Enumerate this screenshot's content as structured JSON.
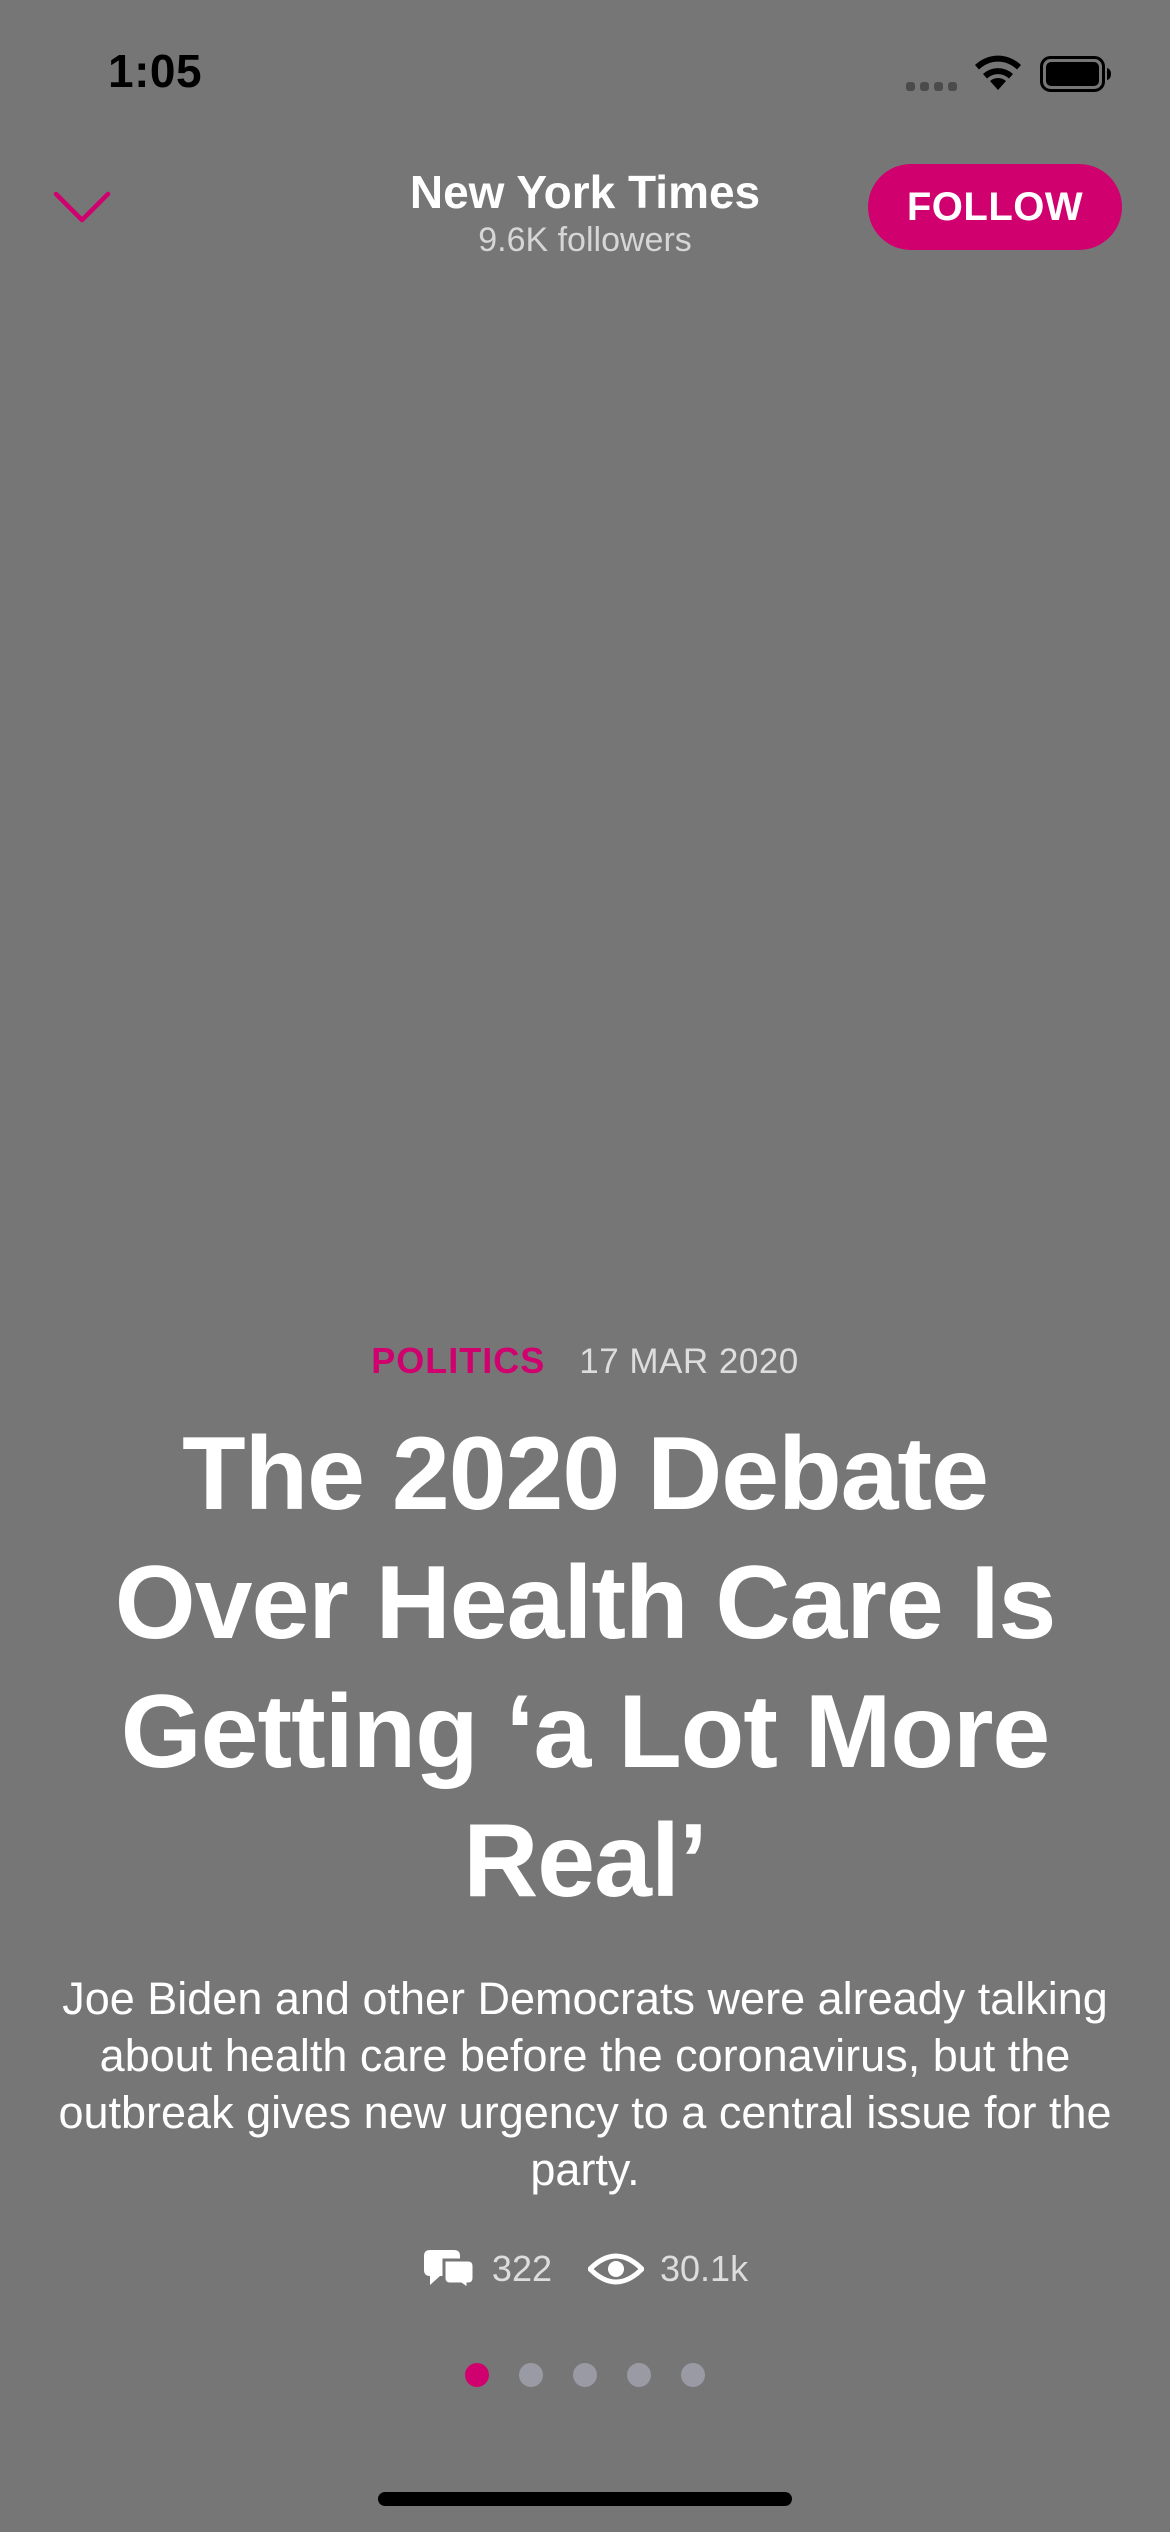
{
  "status_bar": {
    "time": "1:05"
  },
  "header": {
    "publisher_name": "New York Times",
    "followers": "9.6K followers",
    "follow_label": "FOLLOW"
  },
  "article": {
    "category": "POLITICS",
    "date": "17 MAR 2020",
    "headline": "The 2020 Debate Over Health Care Is Getting ‘a Lot More Real’",
    "summary": "Joe Biden and other Democrats were already talking about health care before the coronavirus, but the outbreak gives new urgency to a central issue for the party."
  },
  "stats": {
    "comments": "322",
    "views": "30.1k"
  },
  "pagination": {
    "total": 5,
    "current": 1
  },
  "colors": {
    "background": "#767676",
    "accent": "#d0006f",
    "inactive_dot": "#9a9aa4"
  },
  "icons": [
    "chevron-down-icon",
    "comments-icon",
    "eye-icon",
    "wifi-icon",
    "battery-icon",
    "signal-icon"
  ]
}
